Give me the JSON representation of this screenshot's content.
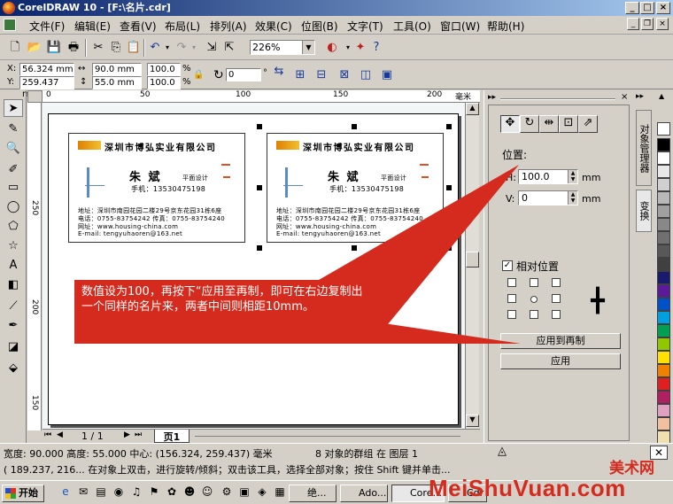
{
  "window": {
    "title": "CorelDRAW 10 - [F:\\名片.cdr]"
  },
  "menubar": {
    "items": [
      "文件(F)",
      "编辑(E)",
      "查看(V)",
      "布局(L)",
      "排列(A)",
      "效果(C)",
      "位图(B)",
      "文字(T)",
      "工具(O)",
      "窗口(W)",
      "帮助(H)"
    ]
  },
  "toolbar": {
    "zoom": "226%"
  },
  "propertybar": {
    "x": "56.324 mm",
    "y": "259.437 mm",
    "w": "90.0 mm",
    "h": "55.0 mm",
    "sx": "100.0",
    "sy": "100.0",
    "pct": "%",
    "rotation": "0",
    "deg": "°",
    "x_lbl": "X:",
    "y_lbl": "Y:"
  },
  "ruler": {
    "top": [
      "0",
      "50",
      "100",
      "150",
      "200",
      "毫米"
    ],
    "left": [
      "250",
      "200",
      "150"
    ]
  },
  "card": {
    "company": "深圳市博弘实业有限公司",
    "name": "朱  斌",
    "role": "平面设计",
    "mobile": "手机：13530475198",
    "address": "地址：深圳市南园花园二楼29号京东花园31栋6座",
    "phone": "电话：0755-83754242    传真：0755-83754240",
    "web": "网址：www.housing-china.com",
    "email": "E-mail: tengyuhaoren@163.net"
  },
  "page_nav": {
    "count": "1 / 1",
    "tab": "页1"
  },
  "docker": {
    "position_label": "位置:",
    "h_label": "H:",
    "h_value": "100.0",
    "v_label": "V:",
    "v_value": "0",
    "unit": "mm",
    "relative_label": "相对位置",
    "apply_copy_label": "应用到再制",
    "apply_label": "应用"
  },
  "docker_tabs": [
    "对象管理器",
    "变换"
  ],
  "callout": {
    "text": "数值设为100，再按下“应用至再制，即可在右边复制出一个同样的名片来，两者中间则相距10mm。"
  },
  "status": {
    "line1": "宽度: 90.000  高度: 55.000  中心: (156.324, 259.437)  毫米",
    "line1b": "8 对象的群组 在 图层 1",
    "line2": "( 189.237, 216...   在对象上双击，进行旋转/倾斜；双击该工具，选择全部对象；按住 Shift 键并单击..."
  },
  "taskbar": {
    "start": "开始",
    "tasks": [
      "绝...",
      "Ado...",
      "Core...",
      "Cdr"
    ]
  },
  "watermark": {
    "top": "美术网",
    "bottom": "MeiShuVuan.com"
  },
  "colors": {
    "title_start": "#0a246a",
    "title_end": "#a6caf0",
    "callout": "#d52b1e",
    "palette": [
      "#000000",
      "#ffffff",
      "#e8e8e8",
      "#d0d0d0",
      "#b8b8b8",
      "#a0a0a0",
      "#888888",
      "#707070",
      "#585858",
      "#404040",
      "#1a1a6e",
      "#5a1a9a",
      "#0050c8",
      "#00a0e0",
      "#00a050",
      "#90c800",
      "#ffe000",
      "#f08000",
      "#e02020",
      "#b02060",
      "#e0a0c0",
      "#f0c0a0",
      "#f0e0b0"
    ]
  }
}
